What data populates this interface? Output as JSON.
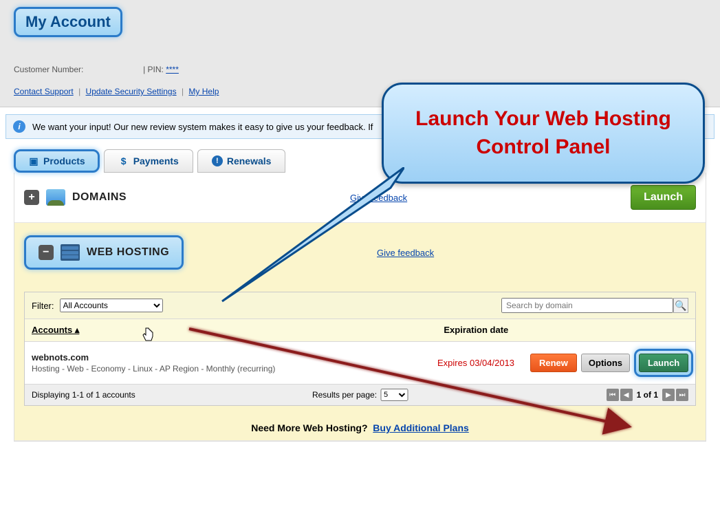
{
  "header": {
    "my_account": "My Account",
    "customer_number_label": "Customer Number:",
    "pin_label": "| PIN:",
    "pin_value": "****",
    "links": {
      "contact": "Contact Support",
      "security": "Update Security Settings",
      "help": "My Help"
    }
  },
  "notice": "We want your input! Our new review system makes it easy to give us your feedback. If",
  "tabs": {
    "products": "Products",
    "payments": "Payments",
    "renewals": "Renewals"
  },
  "sections": {
    "domains": {
      "title": "DOMAINS",
      "feedback": "Give feedback",
      "launch": "Launch"
    },
    "webhosting": {
      "title": "WEB HOSTING",
      "feedback": "Give feedback"
    }
  },
  "panel": {
    "filter_label": "Filter:",
    "filter_value": "All Accounts",
    "search_placeholder": "Search by domain",
    "col_accounts": "Accounts ▴",
    "col_expiration": "Expiration date",
    "row": {
      "name": "webnots.com",
      "desc": "Hosting - Web - Economy - Linux - AP Region - Monthly (recurring)",
      "expires": "Expires 03/04/2013",
      "renew": "Renew",
      "options": "Options",
      "launch": "Launch"
    },
    "pager": {
      "displaying": "Displaying 1-1 of 1 accounts",
      "results_label": "Results per page:",
      "results_value": "5",
      "page_text": "1 of 1"
    },
    "need_more": "Need More Web Hosting?",
    "buy_plans": "Buy Additional Plans"
  },
  "callout": "Launch Your Web Hosting Control Panel"
}
